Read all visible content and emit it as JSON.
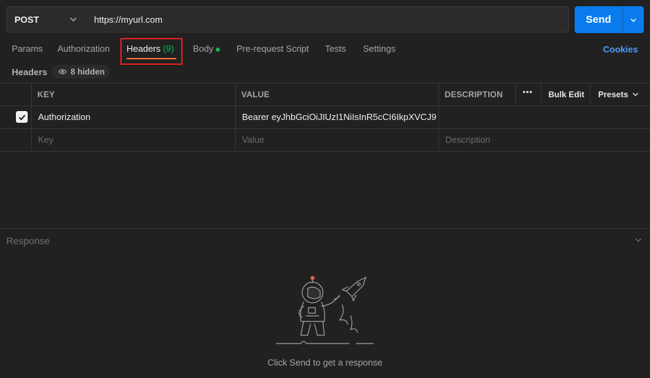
{
  "request": {
    "method": "POST",
    "url": "https://myurl.com",
    "send_label": "Send"
  },
  "tabs": [
    {
      "label": "Params"
    },
    {
      "label": "Authorization"
    },
    {
      "label": "Headers",
      "count": "(9)",
      "active": true
    },
    {
      "label": "Body",
      "has_dot": true
    },
    {
      "label": "Pre-request Script"
    },
    {
      "label": "Tests"
    },
    {
      "label": "Settings"
    }
  ],
  "cookies_label": "Cookies",
  "headers_section": {
    "label": "Headers",
    "hidden_label": "8 hidden"
  },
  "table": {
    "columns": {
      "key": "KEY",
      "value": "VALUE",
      "description": "DESCRIPTION"
    },
    "more_label": "•••",
    "bulk_edit_label": "Bulk Edit",
    "presets_label": "Presets",
    "rows": [
      {
        "checked": true,
        "key": "Authorization",
        "value": "Bearer eyJhbGciOiJIUzI1NiIsInR5cCI6IkpXVCJ9....",
        "description": ""
      }
    ],
    "placeholders": {
      "key": "Key",
      "value": "Value",
      "description": "Description"
    }
  },
  "response": {
    "label": "Response",
    "empty_text": "Click Send to get a response"
  },
  "colors": {
    "background": "#212121",
    "accent_send": "#097bed",
    "active_tab_underline": "#ff6c37",
    "count_green": "#0cbb52",
    "cookies_blue": "#4f9bff",
    "highlight_red": "#e02020"
  },
  "icons": [
    "chevron-down-icon",
    "eye-icon",
    "checkmark-icon",
    "astronaut-illustration"
  ]
}
